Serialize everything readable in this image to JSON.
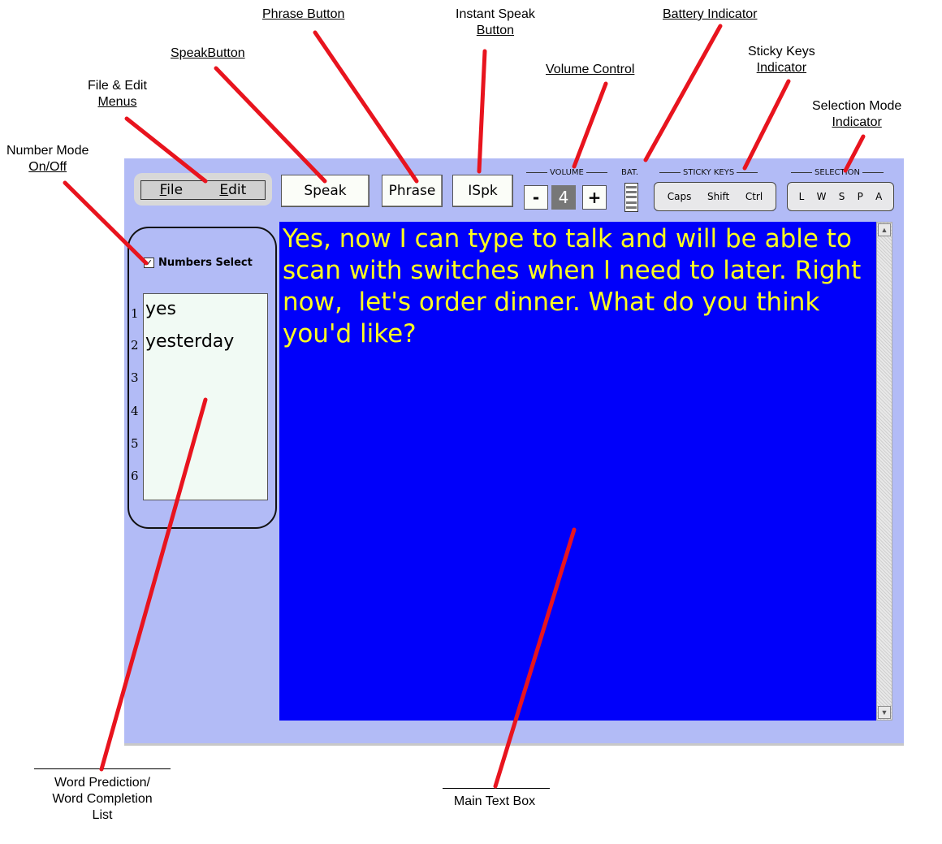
{
  "callouts": {
    "phrase_button": "Phrase Button",
    "instant_speak_1": "Instant Speak",
    "instant_speak_2": "Button",
    "battery": "Battery Indicator",
    "speak_button": "SpeakButton",
    "volume": "Volume Control",
    "sticky_1": "Sticky Keys",
    "sticky_2": "Indicator",
    "file_edit_1": "File & Edit",
    "file_edit_2": "Menus",
    "selection_1": "Selection Mode",
    "selection_2": "Indicator",
    "number_mode_1": "Number Mode",
    "number_mode_2": "On/Off",
    "word_pred_1": "Word Prediction/",
    "word_pred_2": "Word Completion",
    "word_pred_3": "List",
    "main_text_box": "Main Text Box"
  },
  "menu": {
    "file_first": "F",
    "file_rest": "ile",
    "edit_first": "E",
    "edit_rest": "dit"
  },
  "toolbar": {
    "speak_label": "Speak",
    "phrase_label": "Phrase",
    "ispk_label": "ISpk"
  },
  "volume": {
    "label": "VOLUME",
    "minus": "-",
    "level": "4",
    "plus": "+"
  },
  "battery": {
    "label": "BAT."
  },
  "sticky_keys": {
    "label": "STICKY KEYS",
    "keys": [
      "Caps",
      "Shift",
      "Ctrl"
    ]
  },
  "selection": {
    "label": "SELECTION",
    "modes": [
      "L",
      "W",
      "S",
      "P",
      "A"
    ]
  },
  "prediction": {
    "numbers_select_label": "Numbers Select",
    "checked_mark": "✓",
    "numbers": [
      "1",
      "2",
      "3",
      "4",
      "5",
      "6"
    ],
    "words": [
      "yes",
      "yesterday"
    ]
  },
  "main_text": "Yes, now I can type to talk and will be able to scan with switches when I need to later. Right now,  let's order dinner. What do you think you'd like?",
  "colors": {
    "app_background": "#b2bbf6",
    "text_box_background": "#0000fa",
    "text_color": "#ffff1f",
    "callout_line": "#e8141e"
  }
}
